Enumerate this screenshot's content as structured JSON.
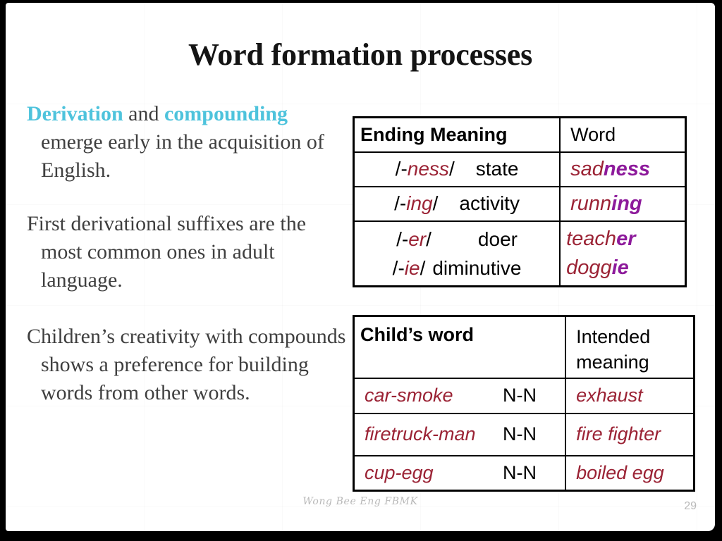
{
  "slide": {
    "title": "Word formation processes",
    "page_number": "29",
    "footer": "Wong Bee Eng FBMK",
    "accent_cyan": "#4ec3dc",
    "accent_dark_red": "#9b2335",
    "accent_purple": "#8d1a9b",
    "background": "#ffffff"
  },
  "body_text": {
    "paragraph1": {
      "highlight1": "Derivation",
      "mid": " and ",
      "highlight2": "compounding",
      "rest": " emerge early in the acquisition of English."
    },
    "paragraph2": "First derivational suffixes are the most common ones in adult language.",
    "paragraph3": "Children’s creativity with compounds shows a preference for building words from other words."
  },
  "table_suffixes": {
    "headers": [
      "Ending Meaning",
      "Word"
    ],
    "rows": [
      {
        "slash_open": "/-",
        "suffix": "ness",
        "slash_close": "/",
        "meaning": "state",
        "word_stem": "sad",
        "word_suffix": "ness"
      },
      {
        "slash_open": "/-",
        "suffix": "ing",
        "slash_close": "/",
        "meaning": "activity",
        "word_stem": "runn",
        "word_suffix": "ing"
      },
      {
        "slash_open": "/-",
        "suffix": "er",
        "slash_close": "/",
        "meaning": "doer",
        "word_stem": "teach",
        "word_suffix": "er"
      },
      {
        "slash_open": "/-",
        "suffix": "ie",
        "slash_close": "/",
        "meaning": "diminutive",
        "word_stem": "dogg",
        "word_suffix": "ie"
      }
    ]
  },
  "table_child_words": {
    "headers": [
      "Child’s word",
      "Intended meaning"
    ],
    "header_right_line1": "Intended",
    "header_right_line2": "meaning",
    "rows": [
      {
        "child_word": "car-smoke",
        "pattern": "N-N",
        "intended_meaning": "exhaust"
      },
      {
        "child_word": "firetruck-man",
        "pattern": "N-N",
        "intended_meaning": "fire fighter"
      },
      {
        "child_word": "cup-egg",
        "pattern": "N-N",
        "intended_meaning": "boiled egg"
      }
    ]
  }
}
